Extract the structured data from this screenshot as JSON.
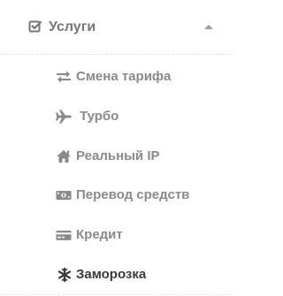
{
  "section": {
    "title": "Услуги",
    "icon": "check-square-icon",
    "expanded": true
  },
  "items": [
    {
      "label": "Смена тарифа",
      "icon": "exchange-icon"
    },
    {
      "label": "Турбо",
      "icon": "plane-icon"
    },
    {
      "label": "Реальный IP",
      "icon": "home-icon"
    },
    {
      "label": "Перевод средств",
      "icon": "money-icon"
    },
    {
      "label": "Кредит",
      "icon": "credit-card-icon"
    },
    {
      "label": "Заморозка",
      "icon": "snowflake-icon",
      "active": true
    }
  ],
  "colors": {
    "muted_text": "#8a8a8a",
    "active_text": "#3a3a3a",
    "header_text": "#777777"
  }
}
